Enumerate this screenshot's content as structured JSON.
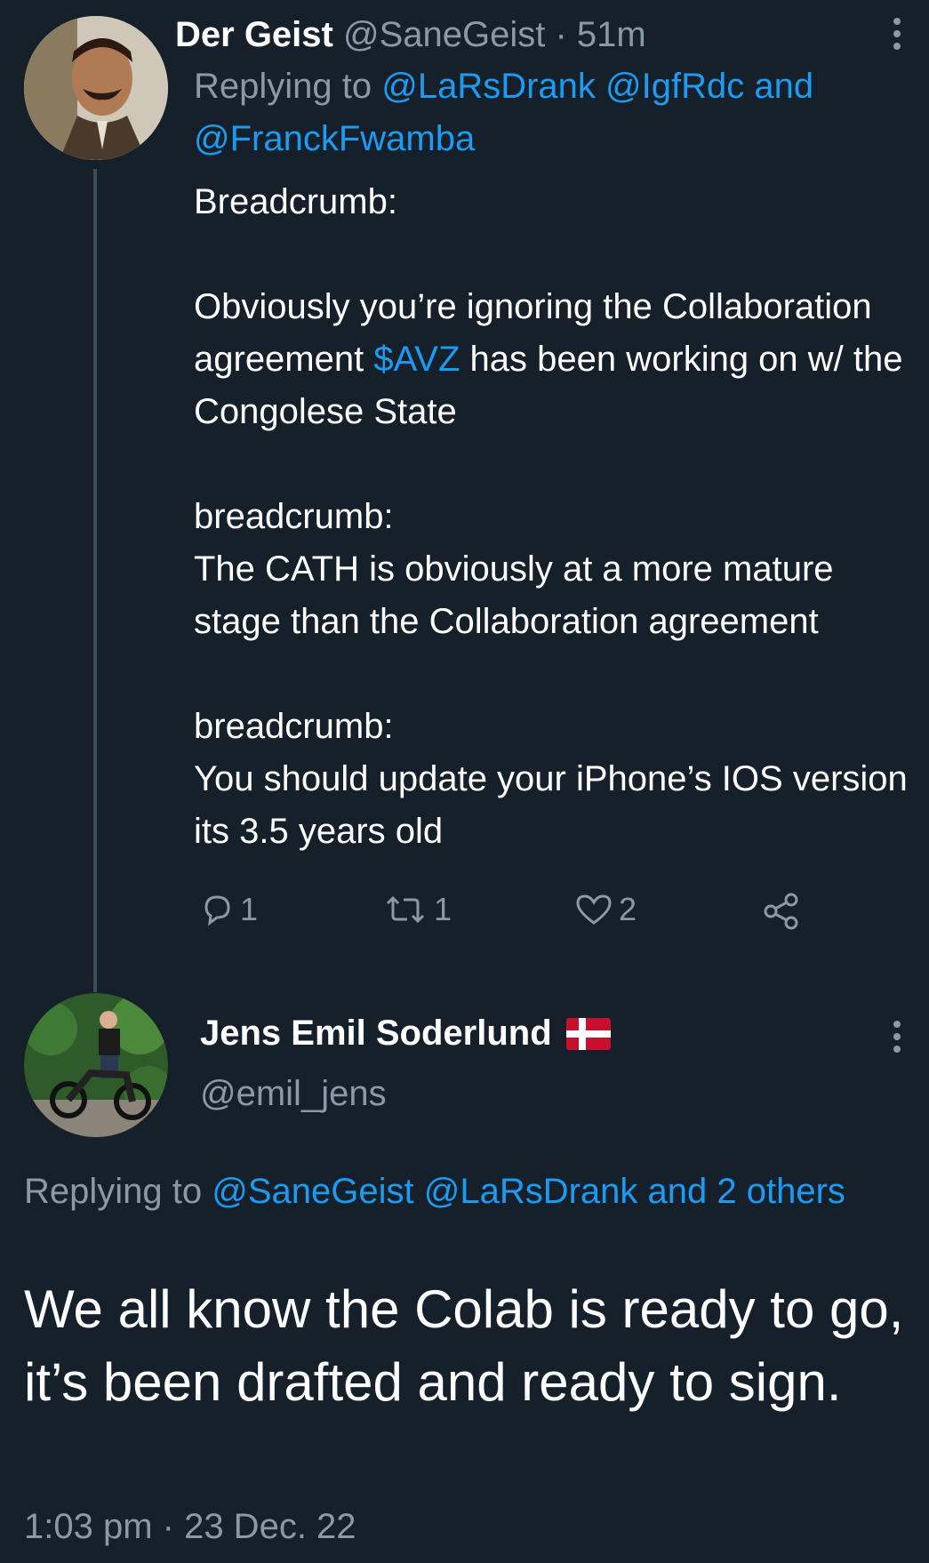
{
  "tweet1": {
    "name": "Der Geist",
    "handle": "@SaneGeist",
    "sep": " · ",
    "time": "51m",
    "replying_prefix": "Replying to ",
    "replying_links": "@LaRsDrank @IgfRdc and @FranckFwamba",
    "text_a": "Breadcrumb:\n\nObviously you’re ignoring the Collaboration agreement ",
    "cashtag": "$AVZ",
    "text_b": " has been working on w/ the Congolese State\n\nbreadcrumb:\nThe CATH is obviously at a more mature stage than the Collaboration agreement\n\nbreadcrumb:\nYou should update your iPhone’s IOS version its 3.5 years old",
    "replies": "1",
    "retweets": "1",
    "likes": "2"
  },
  "tweet2": {
    "name": "Jens Emil Soderlund",
    "handle": "@emil_jens",
    "replying_prefix": "Replying to ",
    "replying_links": "@SaneGeist @LaRsDrank and 2 others",
    "text": "We all know the Colab is ready to go, it’s been drafted and ready to sign.",
    "timestamp": "1:03 pm · 23 Dec. 22"
  },
  "icons": {
    "reply": "reply-icon",
    "retweet": "retweet-icon",
    "like": "heart-icon",
    "share": "share-icon",
    "more": "more-vertical-icon",
    "flag": "denmark-flag-icon"
  },
  "colors": {
    "background": "#15202b",
    "text": "#ffffff",
    "muted": "#8b98a5",
    "link": "#1d9bf0",
    "thread_line": "#3d4d5c"
  }
}
